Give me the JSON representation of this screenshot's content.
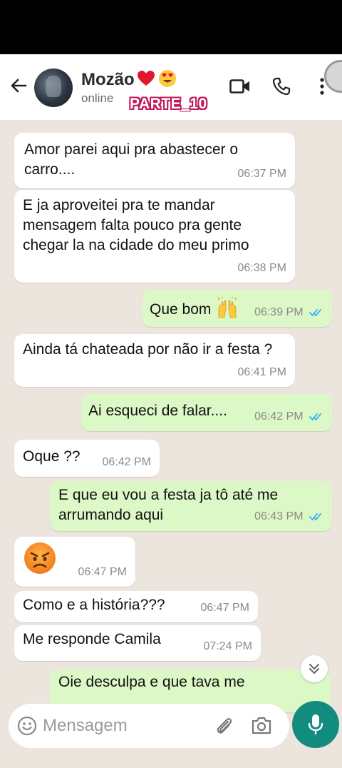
{
  "header": {
    "contact_name": "Mozão",
    "status": "online",
    "overlay_label": "PARTE_10",
    "icons": [
      "back-arrow-icon",
      "red-heart-emoji-icon",
      "heart-eyes-emoji-icon",
      "video-call-icon",
      "phone-call-icon",
      "more-vert-icon"
    ]
  },
  "messages": [
    {
      "direction": "in",
      "text": "Amor parei aqui pra abastecer o carro....",
      "time": "06:37 PM"
    },
    {
      "direction": "in",
      "text": "E ja aproveitei pra te mandar mensagem falta pouco pra gente chegar la na cidade do meu primo",
      "time": "06:38 PM"
    },
    {
      "direction": "out",
      "text": "Que bom",
      "emoji": "raising-hands-emoji",
      "time": "06:39 PM",
      "read": true
    },
    {
      "direction": "in",
      "text": "Ainda tá chateada por não ir a festa ?",
      "time": "06:41 PM"
    },
    {
      "direction": "out",
      "text": "Ai esqueci de falar....",
      "time": "06:42 PM",
      "read": true
    },
    {
      "direction": "in",
      "text": "Oque ??",
      "time": "06:42 PM"
    },
    {
      "direction": "out",
      "text": "E que eu vou a festa  ja tô até me arrumando aqui",
      "time": "06:43 PM",
      "read": true
    },
    {
      "direction": "in",
      "emoji": "angry-face-emoji",
      "time": "06:47 PM"
    },
    {
      "direction": "in",
      "text": "Como e a história???",
      "time": "06:47 PM"
    },
    {
      "direction": "in",
      "text": "Me responde Camila",
      "time": "07:24 PM"
    },
    {
      "direction": "out",
      "text": "Oie desculpa e que tava me"
    }
  ],
  "composer": {
    "placeholder": "Mensagem",
    "icons": [
      "emoji-icon",
      "attach-icon",
      "camera-icon",
      "mic-icon",
      "scroll-down-icon"
    ]
  },
  "colors": {
    "chat_background": "#ece5dd",
    "incoming_bubble": "#ffffff",
    "outgoing_bubble": "#dcf8c6",
    "accent": "#128c7e",
    "read_ticks": "#34b7f1"
  }
}
